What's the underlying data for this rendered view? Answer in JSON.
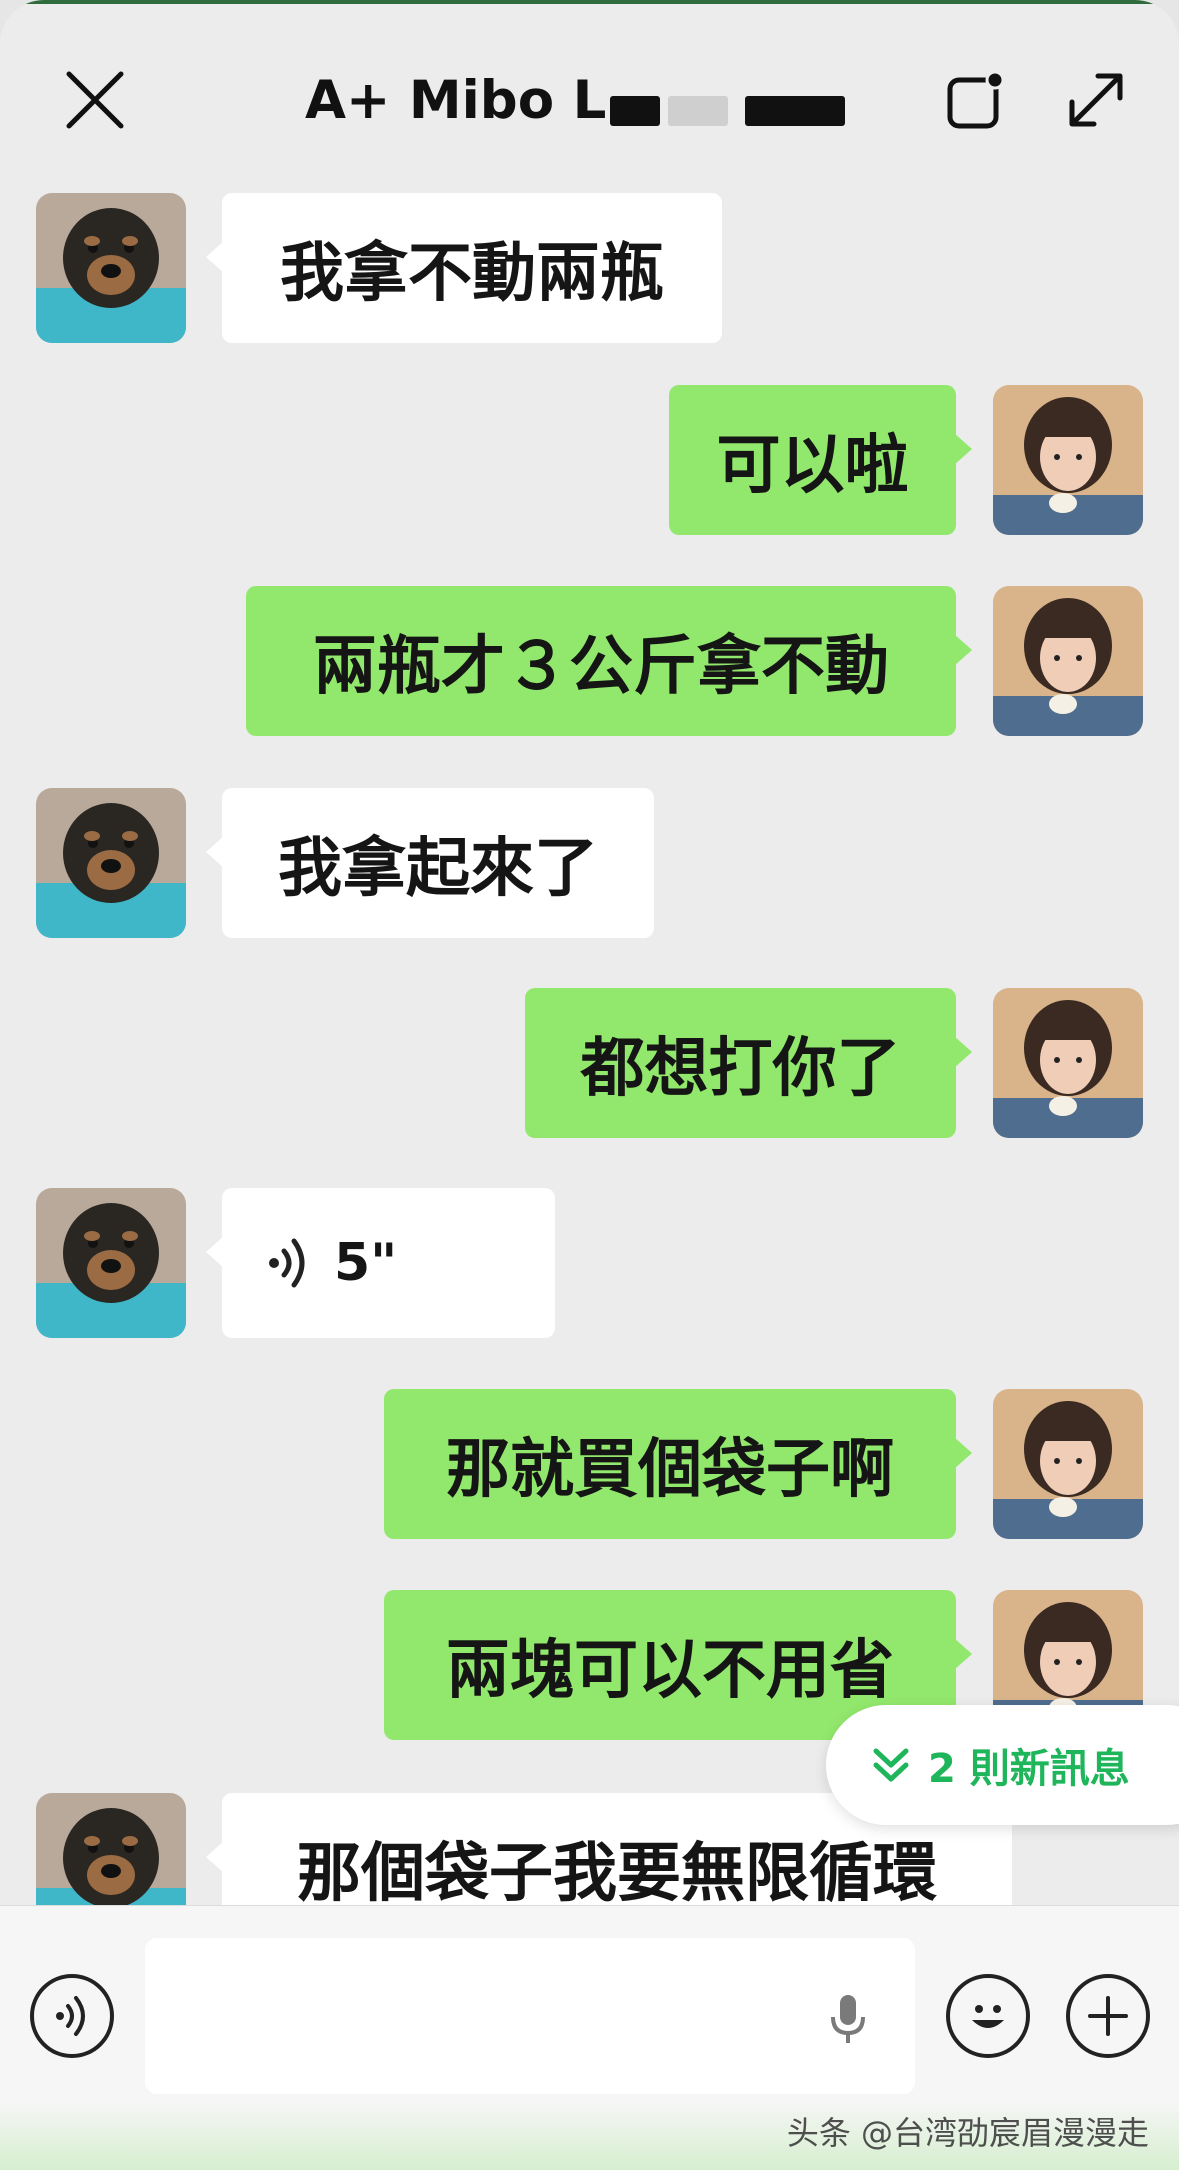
{
  "header": {
    "title": "A+ Mibo L",
    "close_icon": "close-icon",
    "note_icon": "note-icon",
    "expand_icon": "expand-icon"
  },
  "messages": [
    {
      "side": "in",
      "text": "我拿不動兩瓶"
    },
    {
      "side": "out",
      "text": "可以啦"
    },
    {
      "side": "out",
      "text": "兩瓶才３公斤拿不動"
    },
    {
      "side": "in",
      "text": "我拿起來了"
    },
    {
      "side": "out",
      "text": "都想打你了"
    },
    {
      "side": "in",
      "type": "voice",
      "duration": "5\""
    },
    {
      "side": "out",
      "text": "那就買個袋子啊"
    },
    {
      "side": "out",
      "text": "兩塊可以不用省"
    },
    {
      "side": "in",
      "text": "那個袋子我要無限循環"
    }
  ],
  "new_messages_pill": {
    "label": "2 則新訊息"
  },
  "composer": {
    "input_value": "",
    "input_placeholder": "",
    "voice_icon": "voice-icon",
    "mic_icon": "mic-icon",
    "emoji_icon": "emoji-icon",
    "plus_icon": "plus-icon"
  },
  "watermark": "头条 @台湾劭宸眉漫漫走",
  "colors": {
    "background": "#ececec",
    "incoming_bubble": "#ffffff",
    "outgoing_bubble": "#92e86c",
    "accent": "#1fb55a"
  }
}
